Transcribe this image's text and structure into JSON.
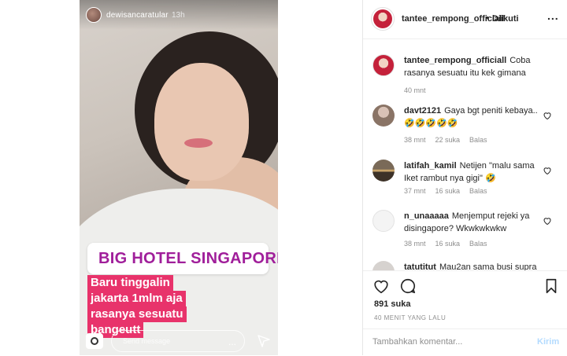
{
  "story": {
    "username": "dewisancaratular",
    "time": "13h",
    "location": "BIG HOTEL SINGAPORE",
    "caption_lines": [
      "Baru tinggalin",
      "jakarta 1mlm aja",
      "rasanya sesuatu",
      "bangeutt"
    ],
    "message_placeholder": "Send message",
    "more_label": "..."
  },
  "header": {
    "username": "tantee_rempong_officiall",
    "dot": "•",
    "follow_label": "Diikuti",
    "more_label": "..."
  },
  "caption_comment": {
    "username": "tantee_rempong_officiall",
    "text": "Coba rasanya sesuatu itu kek gimana",
    "time": "40 mnt"
  },
  "comments": [
    {
      "username": "davt2121",
      "text": "Gaya bgt peniti kebaya.. 🤣🤣🤣🤣🤣",
      "time": "38 mnt",
      "likes": "22 suka",
      "reply": "Balas"
    },
    {
      "username": "latifah_kamil",
      "text": "Netijen \"malu sama Iket rambut nya gigi\" 🤣",
      "time": "37 mnt",
      "likes": "16 suka",
      "reply": "Balas"
    },
    {
      "username": "n_unaaaaa",
      "text": "Menjemput rejeki ya disingapore? Wkwkwkwkw",
      "time": "38 mnt",
      "likes": "16 suka",
      "reply": "Balas"
    },
    {
      "username": "tatutitut",
      "text": "Mau2an sama busi supra",
      "time": "",
      "likes": "",
      "reply": ""
    }
  ],
  "actions": {
    "likes": "891 suka",
    "time_ago": "40 MENIT YANG LALU",
    "comment_placeholder": "Tambahkan komentar...",
    "post_label": "Kirim"
  },
  "colors": {
    "location_text": "#a01e9a",
    "caption_bg": "#e8336b",
    "post_disabled": "#b3dbff"
  }
}
